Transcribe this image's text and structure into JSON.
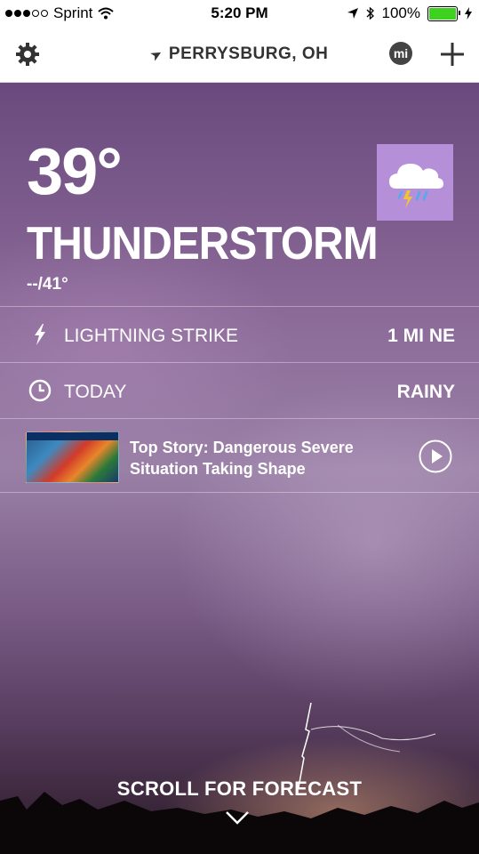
{
  "status_bar": {
    "carrier": "Sprint",
    "time": "5:20 PM",
    "battery": "100%"
  },
  "nav": {
    "location": "PERRYSBURG, OH",
    "badge": "mi"
  },
  "current": {
    "temperature": "39°",
    "condition": "THUNDERSTORM",
    "hi_lo": "--/41°",
    "icon": "thunderstorm-cloud-icon"
  },
  "rows": {
    "lightning_label": "LIGHTNING STRIKE",
    "lightning_value": "1 MI NE",
    "today_label": "TODAY",
    "today_value": "RAINY"
  },
  "story": {
    "title_line1": "Top Story: Dangerous Severe",
    "title_line2": "Situation Taking Shape"
  },
  "footer": {
    "scroll_label": "SCROLL FOR FORECAST"
  },
  "colors": {
    "icon_box": "#b58fd8",
    "battery_fill": "#3fd11f"
  }
}
